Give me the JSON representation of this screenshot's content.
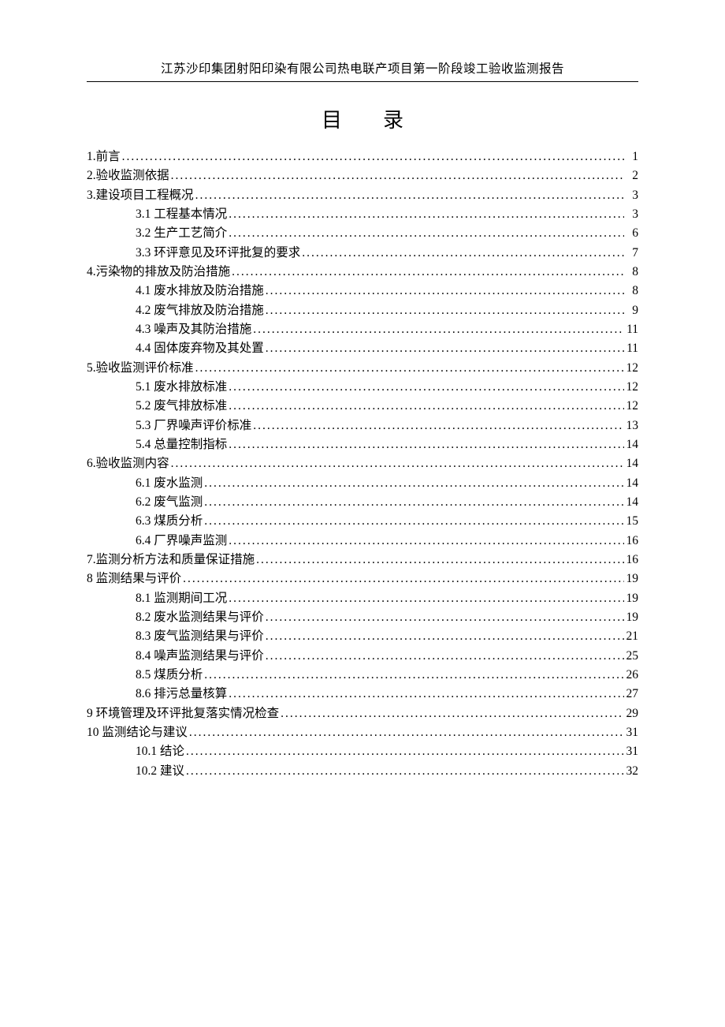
{
  "header": "江苏沙印集团射阳印染有限公司热电联产项目第一阶段竣工验收监测报告",
  "toc_title_a": "目",
  "toc_title_b": "录",
  "toc": [
    {
      "label": "1.前言",
      "page": "1",
      "sub": false
    },
    {
      "label": "2.验收监测依据",
      "page": "2",
      "sub": false
    },
    {
      "label": "3.建设项目工程概况",
      "page": "3",
      "sub": false
    },
    {
      "label": "3.1 工程基本情况",
      "page": "3",
      "sub": true
    },
    {
      "label": "3.2 生产工艺简介",
      "page": "6",
      "sub": true
    },
    {
      "label": "3.3 环评意见及环评批复的要求",
      "page": "7",
      "sub": true
    },
    {
      "label": "4.污染物的排放及防治措施",
      "page": "8",
      "sub": false
    },
    {
      "label": "4.1 废水排放及防治措施",
      "page": "8",
      "sub": true
    },
    {
      "label": "4.2 废气排放及防治措施",
      "page": "9",
      "sub": true
    },
    {
      "label": "4.3 噪声及其防治措施",
      "page": "11",
      "sub": true
    },
    {
      "label": "4.4 固体废弃物及其处置",
      "page": "11",
      "sub": true
    },
    {
      "label": "5.验收监测评价标准",
      "page": "12",
      "sub": false
    },
    {
      "label": "5.1 废水排放标准",
      "page": "12",
      "sub": true
    },
    {
      "label": "5.2 废气排放标准",
      "page": "12",
      "sub": true
    },
    {
      "label": "5.3 厂界噪声评价标准",
      "page": "13",
      "sub": true
    },
    {
      "label": "5.4 总量控制指标",
      "page": "14",
      "sub": true
    },
    {
      "label": "6.验收监测内容",
      "page": "14",
      "sub": false
    },
    {
      "label": "6.1 废水监测",
      "page": "14",
      "sub": true
    },
    {
      "label": "6.2 废气监测",
      "page": "14",
      "sub": true
    },
    {
      "label": "6.3 煤质分析",
      "page": "15",
      "sub": true
    },
    {
      "label": "6.4 厂界噪声监测",
      "page": "16",
      "sub": true
    },
    {
      "label": "7.监测分析方法和质量保证措施",
      "page": "16",
      "sub": false
    },
    {
      "label": "8 监测结果与评价",
      "page": "19",
      "sub": false
    },
    {
      "label": "8.1 监测期间工况",
      "page": "19",
      "sub": true
    },
    {
      "label": "8.2  废水监测结果与评价",
      "page": "19",
      "sub": true
    },
    {
      "label": "8.3 废气监测结果与评价",
      "page": "21",
      "sub": true
    },
    {
      "label": "8.4 噪声监测结果与评价",
      "page": "25",
      "sub": true
    },
    {
      "label": "8.5 煤质分析",
      "page": "26",
      "sub": true
    },
    {
      "label": "8.6 排污总量核算",
      "page": "27",
      "sub": true
    },
    {
      "label": "9  环境管理及环评批复落实情况检查",
      "page": "29",
      "sub": false
    },
    {
      "label": "10 监测结论与建议",
      "page": "31",
      "sub": false
    },
    {
      "label": "10.1 结论",
      "page": "31",
      "sub": true
    },
    {
      "label": "10.2 建议",
      "page": "32",
      "sub": true
    }
  ]
}
